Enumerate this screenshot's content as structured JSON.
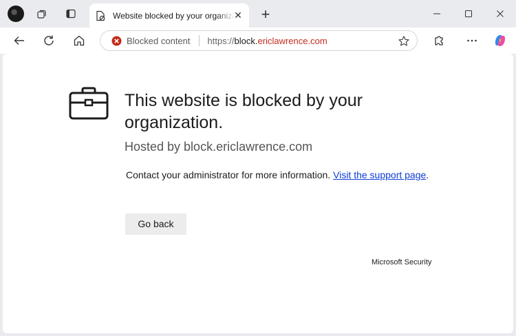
{
  "tab": {
    "title": "Website blocked by your organization",
    "close_glyph": "✕",
    "newtab_glyph": "+"
  },
  "window": {
    "minimize_glyph": "—",
    "maximize_glyph": "☐",
    "close_glyph": "✕"
  },
  "omnibox": {
    "status_label": "Blocked content",
    "url_scheme": "https://",
    "url_subdomain": "block.",
    "url_domain": "ericlawrence.com"
  },
  "page": {
    "headline": "This website is blocked by your organization.",
    "hosted_by": "Hosted by block.ericlawrence.com",
    "contact_text": "Contact your administrator for more information.",
    "support_link": "Visit the support page",
    "contact_period": ".",
    "go_back_label": "Go back",
    "footer": "Microsoft Security"
  },
  "colors": {
    "blocked_red": "#c42b1c",
    "link_blue": "#0b3dd6",
    "button_bg": "#ececec"
  },
  "icons": {
    "profile": "profile-avatar",
    "workspaces": "workspaces-icon",
    "tab_actions": "tab-actions-icon",
    "back": "back-arrow-icon",
    "refresh": "refresh-icon",
    "home": "home-icon",
    "blocked": "blocked-icon",
    "favorite": "star-icon",
    "extensions": "puzzle-icon",
    "more": "more-icon",
    "copilot": "copilot-icon",
    "briefcase": "briefcase-icon"
  }
}
